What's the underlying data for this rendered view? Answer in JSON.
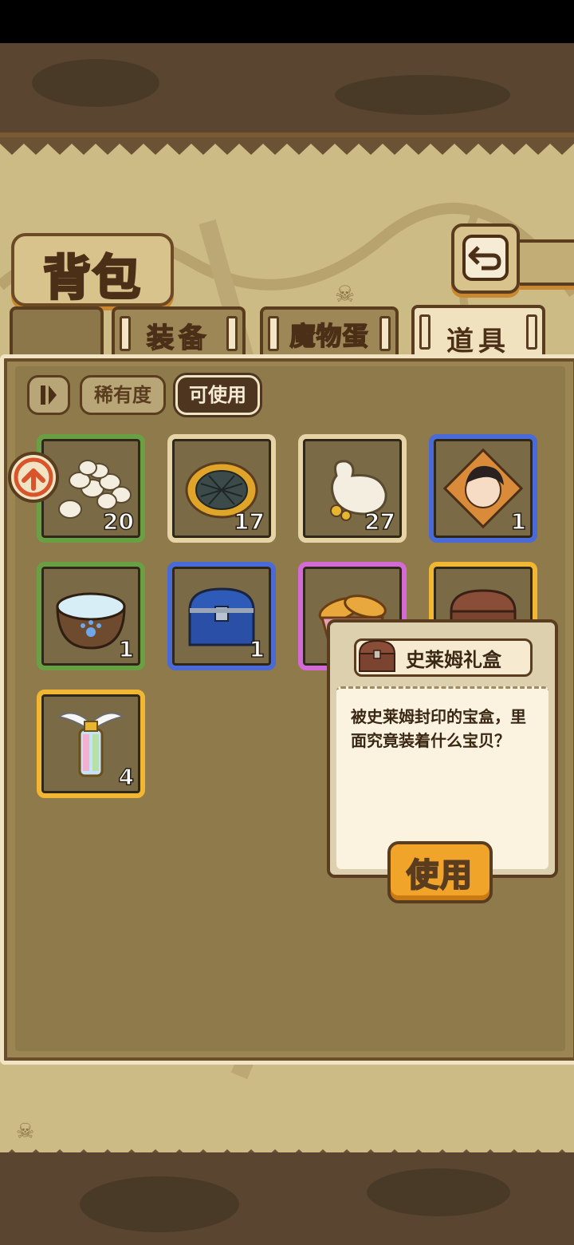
{
  "header": {
    "title": "背包"
  },
  "tabs": [
    {
      "label": "装备",
      "active": false
    },
    {
      "label": "魔物蛋",
      "active": false
    },
    {
      "label": "道具",
      "active": true
    }
  ],
  "filters": {
    "rarity_label": "稀有度",
    "usable_label": "可使用"
  },
  "items": [
    {
      "icon": "egg-pile-icon",
      "count": "20",
      "rarity": "green"
    },
    {
      "icon": "grill-pie-icon",
      "count": "17",
      "rarity": "beige"
    },
    {
      "icon": "coin-sack-icon",
      "count": "27",
      "rarity": "beige"
    },
    {
      "icon": "character-card-icon",
      "count": "1",
      "rarity": "blue"
    },
    {
      "icon": "water-bowl-icon",
      "count": "1",
      "rarity": "green"
    },
    {
      "icon": "blue-chest-icon",
      "count": "1",
      "rarity": "blue"
    },
    {
      "icon": "bread-basket-icon",
      "count": "",
      "rarity": "purple"
    },
    {
      "icon": "brown-chest-icon",
      "count": "",
      "rarity": "gold"
    },
    {
      "icon": "winged-lantern-icon",
      "count": "4",
      "rarity": "gold"
    }
  ],
  "tooltip": {
    "name": "史莱姆礼盒",
    "description": "被史莱姆封印的宝盒，里面究竟装着什么宝贝？",
    "use_label": "使用"
  },
  "colors": {
    "green": "#6aa044",
    "beige": "#e6d3a6",
    "blue": "#4a6ad8",
    "purple": "#d36ad6",
    "gold": "#f2b732"
  }
}
